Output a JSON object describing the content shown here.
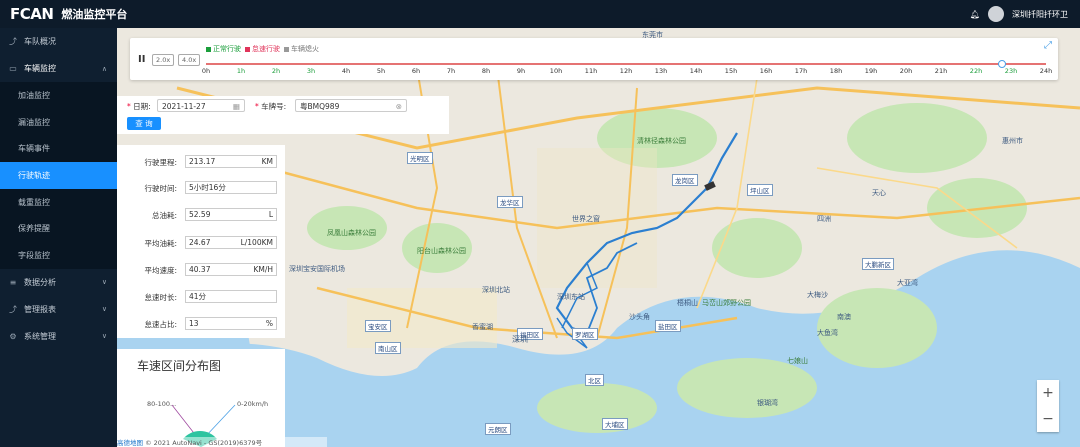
{
  "app": {
    "logo": "FCAN",
    "title": "燃油监控平台"
  },
  "user": {
    "name": "深圳扦阳扦环卫"
  },
  "sidebar": {
    "items": [
      {
        "label": "车队概况"
      },
      {
        "label": "车辆监控"
      },
      {
        "label": "数据分析"
      },
      {
        "label": "管理报表"
      },
      {
        "label": "系统管理"
      }
    ],
    "sub_items": [
      {
        "label": "加油监控"
      },
      {
        "label": "漏油监控"
      },
      {
        "label": "车辆事件"
      },
      {
        "label": "行驶轨迹"
      },
      {
        "label": "载重监控"
      },
      {
        "label": "保养提醒"
      },
      {
        "label": "字段监控"
      }
    ]
  },
  "timeline": {
    "pause": "II",
    "speed_2x": "2.0x",
    "speed_4x": "4.0x",
    "legend": [
      {
        "label": "正常行驶",
        "color": "#1b9e3b"
      },
      {
        "label": "怠速行驶",
        "color": "#e0345a"
      },
      {
        "label": "车辆熄火",
        "color": "#999999"
      }
    ],
    "hours": [
      "0h",
      "1h",
      "2h",
      "3h",
      "4h",
      "5h",
      "6h",
      "7h",
      "8h",
      "9h",
      "10h",
      "11h",
      "12h",
      "13h",
      "14h",
      "15h",
      "16h",
      "17h",
      "18h",
      "19h",
      "20h",
      "21h",
      "22h",
      "23h",
      "24h"
    ]
  },
  "query": {
    "date_label": "日期:",
    "date_value": "2021-11-27",
    "plate_label": "车牌号:",
    "plate_value": "粤BMQ989",
    "button": "查 询"
  },
  "stats": [
    {
      "label": "行驶里程:",
      "value": "213.17",
      "unit": "KM"
    },
    {
      "label": "行驶时间:",
      "value": "5小时16分",
      "unit": ""
    },
    {
      "label": "总油耗:",
      "value": "52.59",
      "unit": "L"
    },
    {
      "label": "平均油耗:",
      "value": "24.67",
      "unit": "L/100KM"
    },
    {
      "label": "平均速度:",
      "value": "40.37",
      "unit": "KM/H"
    },
    {
      "label": "怠速时长:",
      "value": "41分",
      "unit": ""
    },
    {
      "label": "怠速占比:",
      "value": "13",
      "unit": "%"
    }
  ],
  "distribution": {
    "title": "车速区间分布图",
    "label_left": "80-100...",
    "label_right": "0-20km/h"
  },
  "map": {
    "copyright": "© 2021 AutoNavi - GS(2019)6379号",
    "provider": "高德地图",
    "zoom_in": "+",
    "zoom_out": "−",
    "places": {
      "guangming": "光明区",
      "longhua": "龙华区",
      "longgang": "龙岗区",
      "pingshan": "坪山区",
      "baoan": "宝安区",
      "nanshan": "南山区",
      "futian": "福田区",
      "luohu": "罗湖区",
      "yantian": "盐田区",
      "dapeng": "大鹏新区",
      "shenzhen": "深圳",
      "shenzhen_north": "深圳北站",
      "shenzhen_east": "深圳东站",
      "airport": "深圳宝安国际机场",
      "dongguan": "东莞市",
      "huizhou": "惠州市",
      "wutongshan": "梧桐山",
      "qiniangshan": "七娘山",
      "dayawan": "大亚湾",
      "yangtaishan": "阳台山森林公园",
      "fengshan": "凤凰山森林公园",
      "qinglinjing": "清林径森林公园",
      "malanshan": "马峦山郊野公园",
      "window": "世界之窗",
      "dameisha": "大梅沙",
      "nanao": "南澳",
      "shatoujiao": "沙头角",
      "xiangmihu": "香蜜湖",
      "dayuwan": "大鱼湾",
      "tianxin": "天心",
      "sizhou": "四洲",
      "yuanlang": "元朗区",
      "beiqu": "北区",
      "dabuqu": "大埔区",
      "yinyuchi": "银瑚湾"
    }
  },
  "colors": {
    "accent": "#1890ff",
    "route": "#2b7fd0",
    "sidebar": "#0f1f30",
    "topbar": "#0d1b2a"
  }
}
